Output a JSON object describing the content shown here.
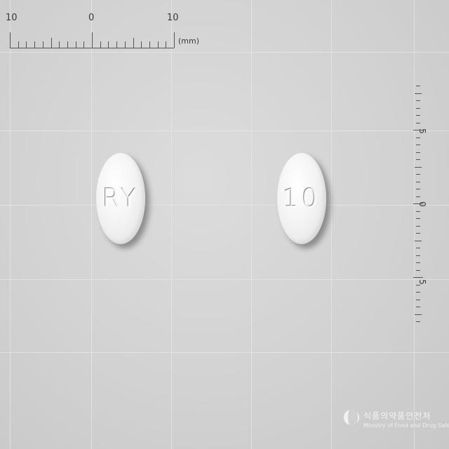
{
  "ruler_top": {
    "labels": [
      "10",
      "0",
      "10"
    ],
    "unit": "(mm)"
  },
  "ruler_right": {
    "labels": [
      "5",
      "0",
      "5"
    ]
  },
  "pills": [
    {
      "name": "pill-front",
      "imprint": "RY"
    },
    {
      "name": "pill-back",
      "imprint": "10"
    }
  ],
  "watermark": {
    "korean": "식품의약품안전처",
    "english": "Ministry of Food and Drug Safety"
  },
  "colors": {
    "background": "#d2d2d2",
    "pill": "#f2f2f2",
    "gridline": "#e6e6e6"
  }
}
